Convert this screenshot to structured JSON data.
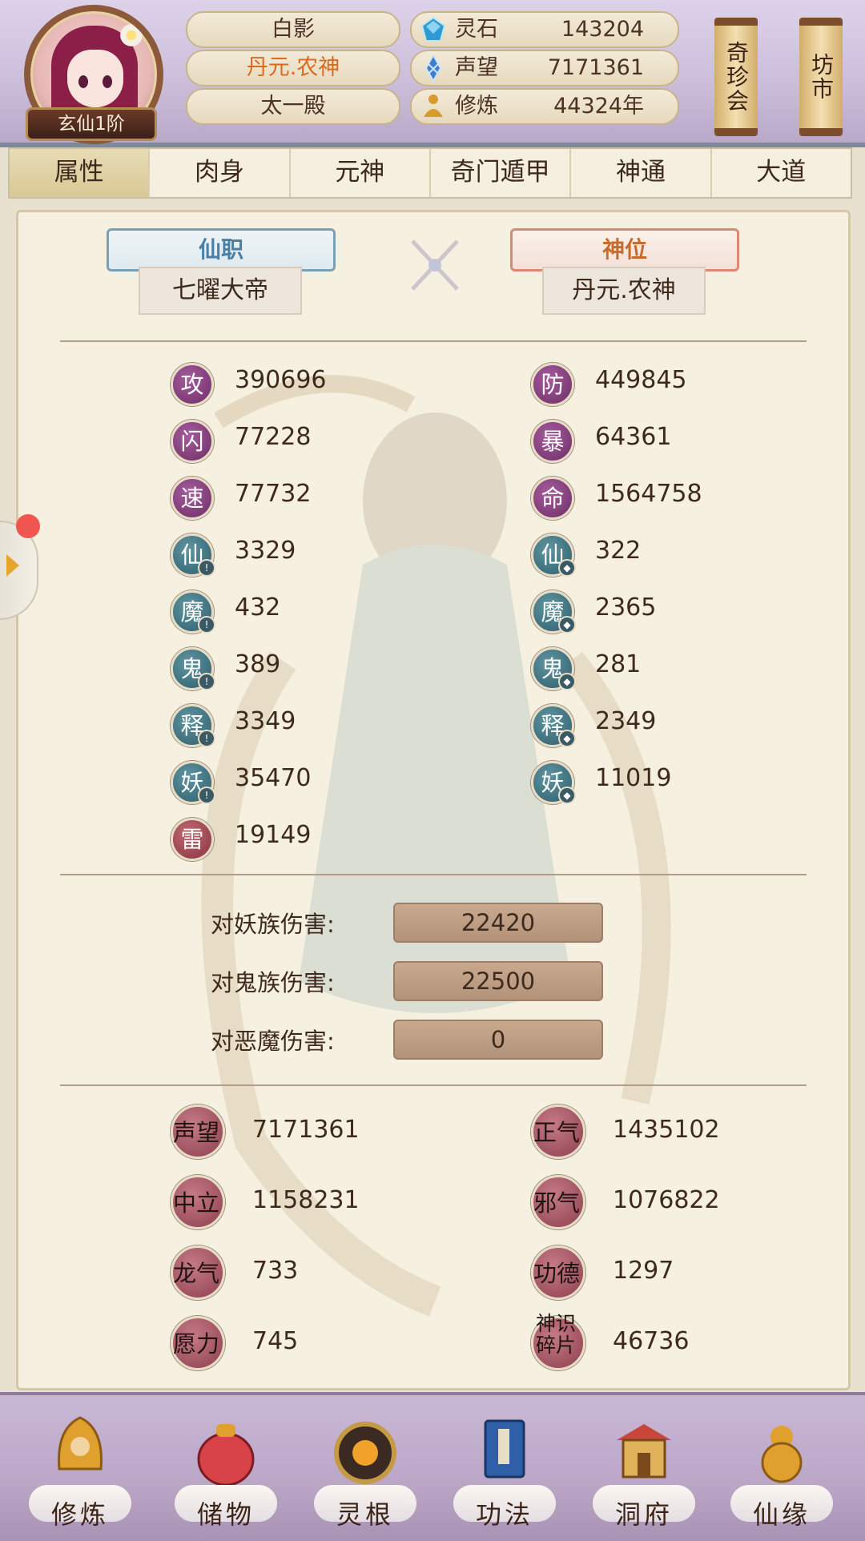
{
  "header": {
    "rank": "玄仙1阶",
    "names": [
      "白影",
      "丹元.农神",
      "太一殿"
    ],
    "resources": [
      {
        "label": "灵石",
        "value": "143204",
        "icon": "spirit-stone-icon",
        "color": "#2f9bd3"
      },
      {
        "label": "声望",
        "value": "7171361",
        "icon": "prestige-crystal-icon",
        "color": "#3c7fd0"
      },
      {
        "label": "修炼",
        "value": "44324年",
        "icon": "meditation-icon",
        "color": "#d99b2b"
      }
    ],
    "scroll_buttons": [
      "奇珍会",
      "坊市"
    ]
  },
  "tabs": [
    "属性",
    "肉身",
    "元神",
    "奇门遁甲",
    "神通",
    "大道"
  ],
  "titles": {
    "office_label": "仙职",
    "office_value": "七曜大帝",
    "deity_label": "神位",
    "deity_value": "丹元.农神"
  },
  "stats_left": [
    {
      "char": "攻",
      "value": "390696",
      "color": "purple"
    },
    {
      "char": "闪",
      "value": "77228",
      "color": "purple"
    },
    {
      "char": "速",
      "value": "77732",
      "color": "purple"
    },
    {
      "char": "仙",
      "value": "3329",
      "color": "teal"
    },
    {
      "char": "魔",
      "value": "432",
      "color": "teal"
    },
    {
      "char": "鬼",
      "value": "389",
      "color": "teal"
    },
    {
      "char": "释",
      "value": "3349",
      "color": "teal"
    },
    {
      "char": "妖",
      "value": "35470",
      "color": "teal"
    },
    {
      "char": "雷",
      "value": "19149",
      "color": "red"
    }
  ],
  "stats_right": [
    {
      "char": "防",
      "value": "449845",
      "color": "purple"
    },
    {
      "char": "暴",
      "value": "64361",
      "color": "purple"
    },
    {
      "char": "命",
      "value": "1564758",
      "color": "purple"
    },
    {
      "char": "仙",
      "value": "322",
      "color": "teal"
    },
    {
      "char": "魔",
      "value": "2365",
      "color": "teal"
    },
    {
      "char": "鬼",
      "value": "281",
      "color": "teal"
    },
    {
      "char": "释",
      "value": "2349",
      "color": "teal"
    },
    {
      "char": "妖",
      "value": "11019",
      "color": "teal"
    }
  ],
  "damage": [
    {
      "label": "对妖族伤害:",
      "value": "22420"
    },
    {
      "label": "对鬼族伤害:",
      "value": "22500"
    },
    {
      "label": "对恶魔伤害:",
      "value": "0"
    }
  ],
  "reputation_left": [
    {
      "label": "声望",
      "value": "7171361"
    },
    {
      "label": "中立",
      "value": "1158231"
    },
    {
      "label": "龙气",
      "value": "733"
    },
    {
      "label": "愿力",
      "value": "745"
    }
  ],
  "reputation_right": [
    {
      "label": "正气",
      "value": "1435102"
    },
    {
      "label": "邪气",
      "value": "1076822"
    },
    {
      "label": "功德",
      "value": "1297"
    },
    {
      "label": "神识碎片",
      "value": "46736"
    }
  ],
  "bottom_nav": [
    "修炼",
    "储物",
    "灵根",
    "功法",
    "洞府",
    "仙缘"
  ]
}
